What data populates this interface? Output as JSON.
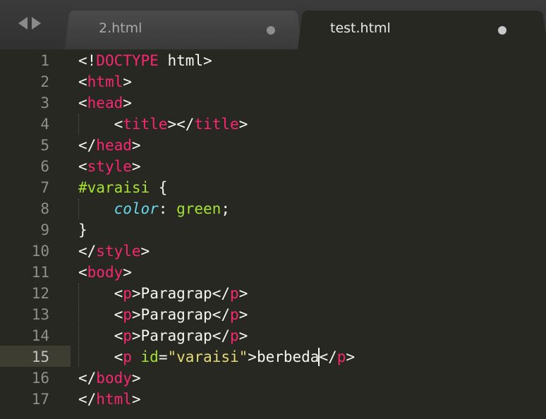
{
  "tabs": [
    {
      "label": "2.html",
      "active": false
    },
    {
      "label": "test.html",
      "active": true
    }
  ],
  "editor": {
    "lines": [
      {
        "num": "1"
      },
      {
        "num": "2"
      },
      {
        "num": "3"
      },
      {
        "num": "4"
      },
      {
        "num": "5"
      },
      {
        "num": "6"
      },
      {
        "num": "7"
      },
      {
        "num": "8"
      },
      {
        "num": "9"
      },
      {
        "num": "10"
      },
      {
        "num": "11"
      },
      {
        "num": "12"
      },
      {
        "num": "13"
      },
      {
        "num": "14"
      },
      {
        "num": "15"
      },
      {
        "num": "16"
      },
      {
        "num": "17"
      }
    ],
    "current_line": "15",
    "tokens": {
      "lt": "<",
      "gt": ">",
      "lt_slash": "</",
      "doctype_bang": "<!",
      "doctype": "DOCTYPE",
      "html_kw": " html",
      "html": "html",
      "head": "head",
      "title": "title",
      "style": "style",
      "body": "body",
      "p": "p",
      "selector": "#varaisi",
      "brace_open": " {",
      "brace_close": "}",
      "indent": "    ",
      "prop": "color",
      "colon": ": ",
      "value": "green",
      "semi": ";",
      "para_text": "Paragrap",
      "attr_name": " id",
      "eq": "=",
      "attr_value": "\"varaisi\"",
      "berbeda_text": "berbeda"
    }
  },
  "colors": {
    "background": "#272822",
    "tag": "#f92672",
    "attribute": "#a6e22e",
    "string": "#e6db74",
    "property": "#66d9ef",
    "text": "#f8f8f2",
    "gutter": "#8f908a"
  }
}
